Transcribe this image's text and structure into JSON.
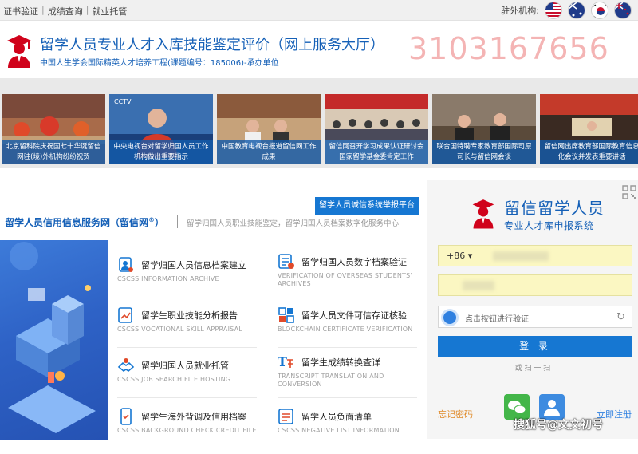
{
  "topbar": {
    "links": [
      "证书验证",
      "成绩查询",
      "就业托管"
    ],
    "branches_label": "驻外机构:",
    "flags": [
      "usa-flag",
      "australia-flag",
      "korea-flag",
      "nz-flag"
    ]
  },
  "header": {
    "title": "留学人员专业人才入库技能鉴定评价（网上服务大厅）",
    "subtitle": "中国人生学会国际精英人才培养工程(课题编号：185006)-承办单位",
    "phone": "3103167656"
  },
  "news": [
    {
      "caption": "北京留科院庆祝国七十华诞留信网驻(境)外机构纷纷祝贺",
      "icon": "photo-celebration"
    },
    {
      "caption": "中央电视台对留学归国人员工作机构做出重要指示",
      "icon": "photo-cctv"
    },
    {
      "caption": "中国教育电视台报道留信网工作成果",
      "icon": "photo-cetv"
    },
    {
      "caption": "留信网召开学习成果认证研讨会国家留学基金委肯定工作",
      "icon": "photo-seminar"
    },
    {
      "caption": "联合国特聘专家教育部国际司原司长与留信网会谈",
      "icon": "photo-meeting"
    },
    {
      "caption": "留信网出席教育部国际教育信息化会议并发表重要讲话",
      "icon": "photo-conference"
    }
  ],
  "services": {
    "platform_link": "留学人员诚信系统举报平台",
    "title": "留学人员信用信息服务网（留信网",
    "title_sup": "®",
    "title_end": "）",
    "subtitle": "留学归国人员职业技能鉴定，留学归国人员档案数字化服务中心",
    "items": [
      {
        "cn": "留学归国人员信息档案建立",
        "en": "CSCSS INFORMATION ARCHIVE",
        "icon": "archive-person-icon"
      },
      {
        "cn": "留学归国人员数字档案验证",
        "en": "VERIFICATION OF OVERSEAS STUDENTS' ARCHIVES",
        "icon": "archive-verify-icon"
      },
      {
        "cn": "留学生职业技能分析报告",
        "en": "CSCSS VOCATIONAL SKILL APPRAISAL",
        "icon": "report-chart-icon"
      },
      {
        "cn": "留学人员文件可信存证核验",
        "en": "BLOCKCHAIN CERTIFICATE VERIFICATION",
        "icon": "blockchain-icon"
      },
      {
        "cn": "留学归国人员就业托管",
        "en": "CSCSS JOB SEARCH FILE HOSTING",
        "icon": "handshake-icon"
      },
      {
        "cn": "留学生成绩转换查详",
        "en": "TRANSCRIPT TRANSLATION AND CONVERSION",
        "icon": "translate-icon"
      },
      {
        "cn": "留学生海外背调及信用档案",
        "en": "CSCSS BACKGROUND CHECK CREDIT FILE",
        "icon": "phone-check-icon"
      },
      {
        "cn": "留学人员负面清单",
        "en": "CSCSS NEGATIVE LIST INFORMATION",
        "icon": "list-icon"
      }
    ]
  },
  "login": {
    "brand_title": "留信留学人员",
    "brand_sub": "专业人才库申报系统",
    "country_code": "+86",
    "verify_text": "点击按钮进行验证",
    "login_label": "登 录",
    "or_scan": "或 扫 一 扫",
    "forgot": "忘记密码",
    "register": "立即注册"
  },
  "watermark": "搜狐号@文文初号",
  "colors": {
    "brand_blue": "#1560b7",
    "button_blue": "#1677d2",
    "phone_pink": "#f4b4b4"
  }
}
